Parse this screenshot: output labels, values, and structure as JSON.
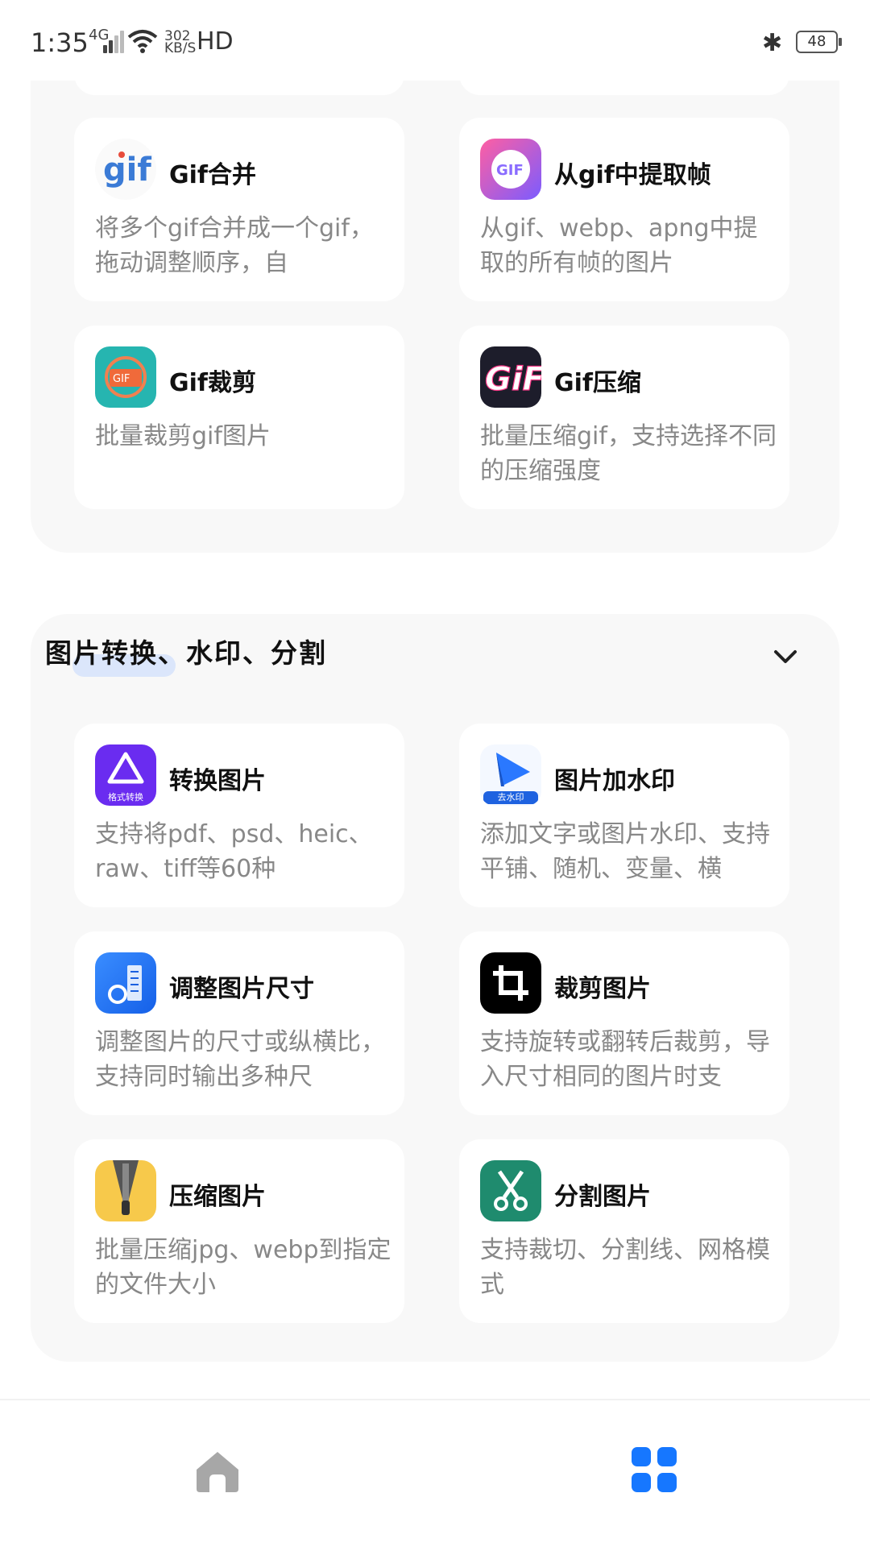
{
  "status_bar": {
    "time": "1:35",
    "network": "4G",
    "speed_value": "302",
    "speed_unit": "KB/S",
    "hd": "HD",
    "battery": "48"
  },
  "section_gif": {
    "items": [
      {
        "title": "Gif合并",
        "desc": "将多个gif合并成一个gif，拖动调整顺序，自",
        "icon": "gif-merge-icon"
      },
      {
        "title": "从gif中提取帧",
        "desc": "从gif、webp、apng中提取的所有帧的图片",
        "icon": "gif-extract-icon"
      },
      {
        "title": "Gif裁剪",
        "desc": "批量裁剪gif图片",
        "icon": "gif-crop-icon"
      },
      {
        "title": "Gif压缩",
        "desc": "批量压缩gif，支持选择不同的压缩强度",
        "icon": "gif-compress-icon"
      }
    ]
  },
  "section_convert": {
    "title": "图片转换、水印、分割",
    "items": [
      {
        "title": "转换图片",
        "desc": "支持将pdf、psd、heic、raw、tiff等60种",
        "icon_label": "格式转换",
        "icon": "convert-image-icon"
      },
      {
        "title": "图片加水印",
        "desc": "添加文字或图片水印、支持平铺、随机、变量、横",
        "icon_label": "去水印",
        "icon": "watermark-icon"
      },
      {
        "title": "调整图片尺寸",
        "desc": "调整图片的尺寸或纵横比，支持同时输出多种尺",
        "icon": "resize-image-icon"
      },
      {
        "title": "裁剪图片",
        "desc": "支持旋转或翻转后裁剪，导入尺寸相同的图片时支",
        "icon": "crop-image-icon"
      },
      {
        "title": "压缩图片",
        "desc": "批量压缩jpg、webp到指定的文件大小",
        "icon": "compress-image-icon"
      },
      {
        "title": "分割图片",
        "desc": "支持裁切、分割线、网格模式",
        "icon": "split-image-icon"
      }
    ]
  },
  "bottom_nav": {
    "items": [
      {
        "icon": "home-icon"
      },
      {
        "icon": "apps-grid-icon",
        "color": "#1677ff"
      }
    ]
  },
  "colors": {
    "accent": "#1677ff",
    "section_bg": "#f8f8f8",
    "desc_text": "#888888"
  }
}
